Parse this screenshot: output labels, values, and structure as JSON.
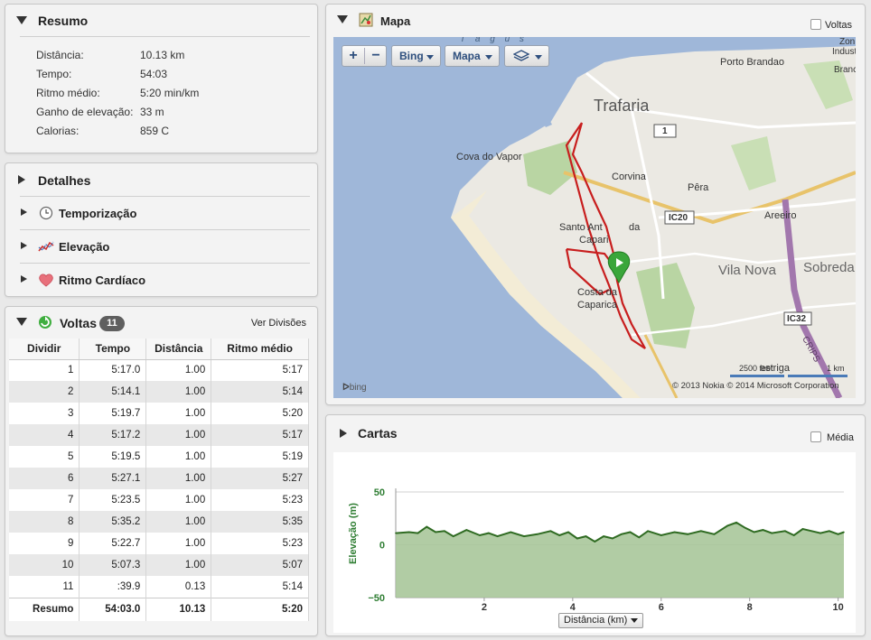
{
  "summary": {
    "title": "Resumo",
    "rows": [
      {
        "label": "Distância:",
        "value": "10.13 km"
      },
      {
        "label": "Tempo:",
        "value": "54:03"
      },
      {
        "label": "Ritmo médio:",
        "value": "5:20 min/km"
      },
      {
        "label": "Ganho de elevação:",
        "value": "33 m"
      },
      {
        "label": "Calorias:",
        "value": "859 C"
      }
    ]
  },
  "details": {
    "title": "Detalhes",
    "items": [
      {
        "label": "Temporização",
        "icon": "clock-icon"
      },
      {
        "label": "Elevação",
        "icon": "elevation-icon"
      },
      {
        "label": "Ritmo Cardíaco",
        "icon": "heart-icon"
      }
    ]
  },
  "laps": {
    "title": "Voltas",
    "count": "11",
    "splits_link": "Ver Divisões",
    "headers": [
      "Dividir",
      "Tempo",
      "Distância",
      "Ritmo médio"
    ],
    "rows": [
      [
        "1",
        "5:17.0",
        "1.00",
        "5:17"
      ],
      [
        "2",
        "5:14.1",
        "1.00",
        "5:14"
      ],
      [
        "3",
        "5:19.7",
        "1.00",
        "5:20"
      ],
      [
        "4",
        "5:17.2",
        "1.00",
        "5:17"
      ],
      [
        "5",
        "5:19.5",
        "1.00",
        "5:19"
      ],
      [
        "6",
        "5:27.1",
        "1.00",
        "5:27"
      ],
      [
        "7",
        "5:23.5",
        "1.00",
        "5:23"
      ],
      [
        "8",
        "5:35.2",
        "1.00",
        "5:35"
      ],
      [
        "9",
        "5:22.7",
        "1.00",
        "5:23"
      ],
      [
        "10",
        "5:07.3",
        "1.00",
        "5:07"
      ],
      [
        "11",
        ":39.9",
        "0.13",
        "5:14"
      ]
    ],
    "total": [
      "Resumo",
      "54:03.0",
      "10.13",
      "5:20"
    ]
  },
  "map": {
    "title": "Mapa",
    "laps_toggle": "Voltas",
    "zoom_in": "+",
    "zoom_out": "−",
    "provider_btn": "Bing",
    "type_btn": "Mapa",
    "labels": {
      "trafaria": "Trafaria",
      "porto_brandao": "Porto Brandao",
      "cova_do_vapor": "Cova do Vapor",
      "corvina": "Corvina",
      "pera": "Pêra",
      "areeiro": "Areeiro",
      "santo_antonio": "Santo Ant",
      "santo_antonio_suffix": "da",
      "caparica_frag": "Capari",
      "vila_nova": "Vila Nova",
      "sobreda": "Sobreda",
      "costa": "Costa da",
      "caparica": "Caparica",
      "zone_top": "Zon",
      "zone_mid": "Indust",
      "zone_bot": "Branc",
      "tagus": "T a g u s",
      "road1": "1",
      "ic20": "IC20",
      "ic32": "IC32",
      "crips": "CRIPS",
      "estriga": "estriga",
      "scale_ft": "2500 feet",
      "scale_km": "1 km",
      "bing_logo": "bing",
      "copyright": "© 2013 Nokia   © 2014 Microsoft Corporation"
    },
    "colors": {
      "water": "#9fb7d9",
      "land": "#ebe9e3",
      "park": "#b9d5a3",
      "route": "#c81e1e",
      "highway": "#a277ad",
      "road": "#e8c36a"
    }
  },
  "charts": {
    "title": "Cartas",
    "average_toggle": "Média",
    "axis_select": "Distância (km)",
    "ylabel": "Elevação (m)",
    "yticks": [
      "50",
      "0",
      "−50"
    ],
    "xticks": [
      "2",
      "4",
      "6",
      "8",
      "10"
    ]
  },
  "chart_data": {
    "type": "area",
    "xlabel": "Distância (km)",
    "ylabel": "Elevação (m)",
    "xlim": [
      0,
      10.13
    ],
    "ylim": [
      -50,
      50
    ],
    "grid": true,
    "series": [
      {
        "x": [
          0,
          0.3,
          0.5,
          0.7,
          0.9,
          1.1,
          1.3,
          1.6,
          1.9,
          2.1,
          2.3,
          2.6,
          2.9,
          3.2,
          3.5,
          3.7,
          3.9,
          4.1,
          4.3,
          4.5,
          4.7,
          4.9,
          5.1,
          5.3,
          5.5,
          5.7,
          6.0,
          6.3,
          6.6,
          6.9,
          7.2,
          7.5,
          7.7,
          7.9,
          8.1,
          8.3,
          8.5,
          8.8,
          9.0,
          9.2,
          9.4,
          9.6,
          9.8,
          10.0,
          10.13
        ],
        "values": [
          11,
          12,
          11,
          17,
          12,
          13,
          8,
          14,
          9,
          11,
          8,
          12,
          8,
          10,
          13,
          9,
          12,
          6,
          8,
          3,
          8,
          6,
          10,
          12,
          7,
          13,
          9,
          12,
          10,
          13,
          10,
          18,
          21,
          16,
          12,
          14,
          11,
          13,
          9,
          15,
          13,
          11,
          13,
          10,
          12
        ]
      }
    ]
  }
}
